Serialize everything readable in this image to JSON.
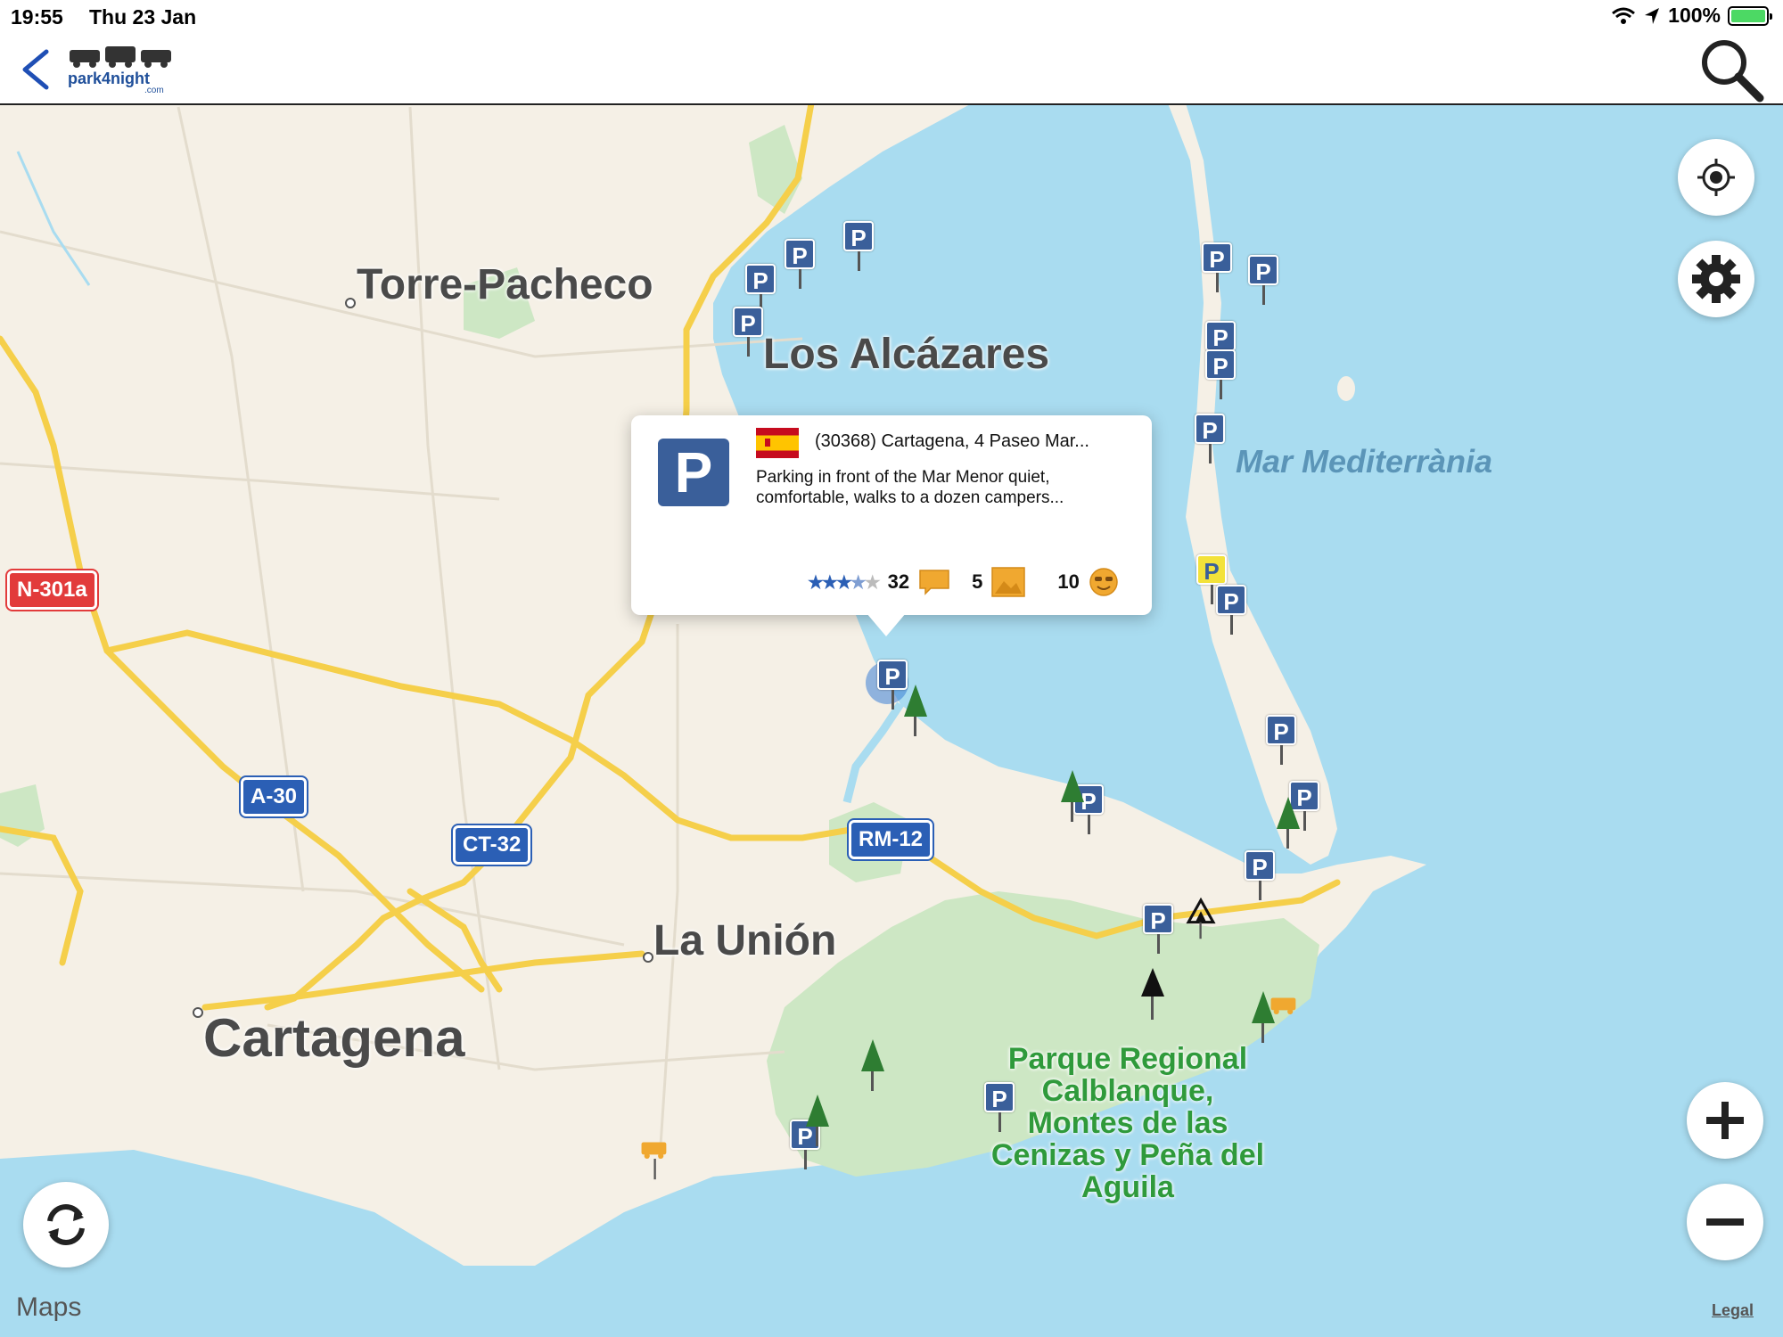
{
  "status_bar": {
    "time": "19:55",
    "date": "Thu 23 Jan",
    "battery": "100%"
  },
  "header": {
    "app_name": "park4night",
    "app_name_suffix": ".com"
  },
  "map_labels": {
    "torre_pacheco": "Torre-Pacheco",
    "los_alcazares": "Los Alcázares",
    "la_union": "La Unión",
    "cartagena": "Cartagena",
    "sea": "Mar Mediterrània",
    "park": "Parque Regional Calblanque, Montes de las Cenizas y Peña del Aguila"
  },
  "road_shields": {
    "n301a": "N-301a",
    "a30": "A-30",
    "ct32": "CT-32",
    "rm12": "RM-12"
  },
  "popup": {
    "address": "(30368) Cartagena, 4 Paseo Mar...",
    "description": "Parking in front of the Mar Menor quiet, comfortable, walks to a dozen campers...",
    "rating": 3.5,
    "comments_count": "32",
    "photos_count": "5",
    "likes_count": "10"
  },
  "footer": {
    "maps_credit": "Maps",
    "legal": "Legal"
  },
  "colors": {
    "sea": "#a9dcf0",
    "land": "#f5f0e6",
    "park_green": "#cde7c4",
    "road_yellow": "#f5cf4a",
    "marker_blue": "#3a5f9a",
    "brand_blue": "#1f4f9a"
  }
}
